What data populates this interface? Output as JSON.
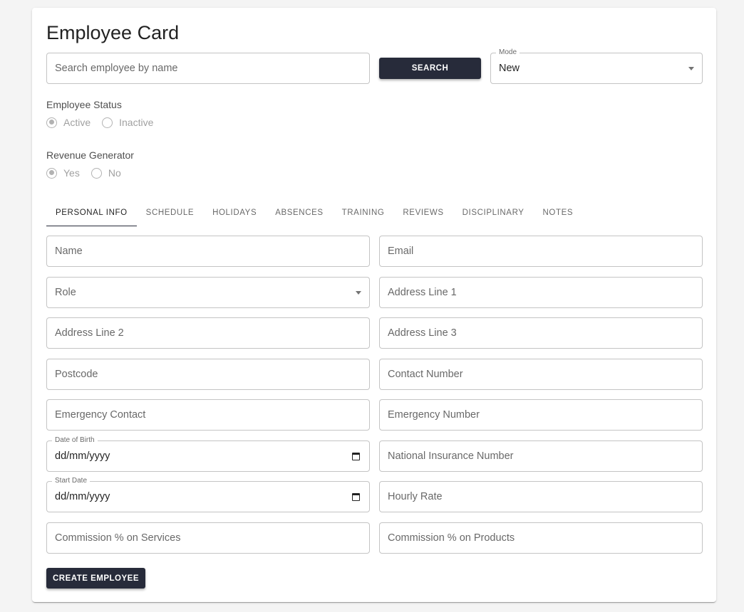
{
  "page": {
    "title": "Employee Card"
  },
  "search": {
    "placeholder": "Search employee by name",
    "button_label": "SEARCH"
  },
  "mode": {
    "label": "Mode",
    "value": "New"
  },
  "employee_status": {
    "label": "Employee Status",
    "options": [
      {
        "label": "Active",
        "selected": true
      },
      {
        "label": "Inactive",
        "selected": false
      }
    ]
  },
  "revenue_generator": {
    "label": "Revenue Generator",
    "options": [
      {
        "label": "Yes",
        "selected": true
      },
      {
        "label": "No",
        "selected": false
      }
    ]
  },
  "tabs": [
    "PERSONAL INFO",
    "SCHEDULE",
    "HOLIDAYS",
    "ABSENCES",
    "TRAINING",
    "REVIEWS",
    "DISCIPLINARY",
    "NOTES"
  ],
  "form": {
    "name": "Name",
    "email": "Email",
    "role": "Role",
    "address_line_1": "Address Line 1",
    "address_line_2": "Address Line 2",
    "address_line_3": "Address Line 3",
    "postcode": "Postcode",
    "contact_number": "Contact Number",
    "emergency_contact": "Emergency Contact",
    "emergency_number": "Emergency Number",
    "date_of_birth": {
      "label": "Date of Birth",
      "value": "dd/mm/yyyy"
    },
    "national_insurance": "National Insurance Number",
    "start_date": {
      "label": "Start Date",
      "value": "dd/mm/yyyy"
    },
    "hourly_rate": "Hourly Rate",
    "commission_services": "Commission % on Services",
    "commission_products": "Commission % on Products"
  },
  "submit": {
    "label": "CREATE EMPLOYEE"
  }
}
